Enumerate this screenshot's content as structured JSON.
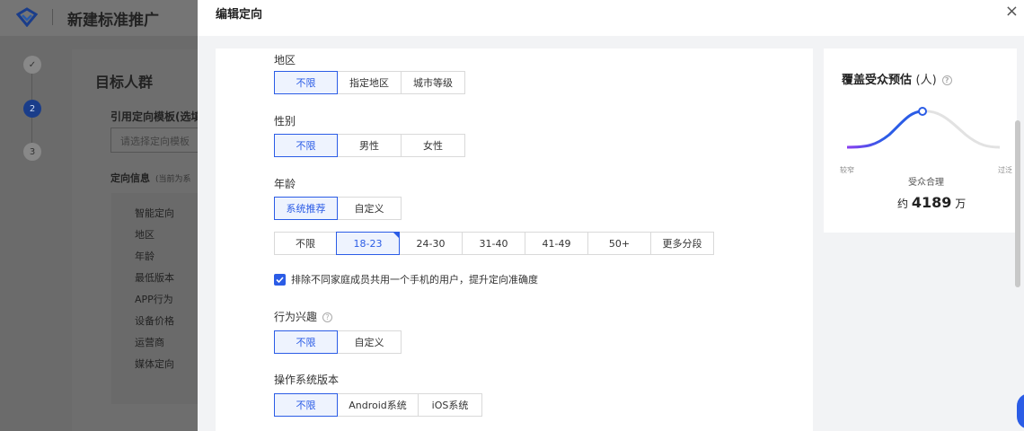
{
  "background": {
    "app_title": "新建标准推广",
    "steps": [
      "✓",
      "2",
      "3"
    ],
    "section_heading": "目标人群",
    "template_label": "引用定向模板(选填)",
    "template_placeholder": "请选择定向模板",
    "info_label": "定向信息",
    "info_note": "(当前为系",
    "list_items": [
      "智能定向",
      "地区",
      "年龄",
      "最低版本",
      "APP行为",
      "设备价格",
      "运营商",
      "媒体定向"
    ]
  },
  "drawer": {
    "title": "编辑定向",
    "close": "×"
  },
  "form": {
    "region": {
      "label": "地区",
      "options": [
        "不限",
        "指定地区",
        "城市等级"
      ],
      "selected": 0
    },
    "gender": {
      "label": "性别",
      "options": [
        "不限",
        "男性",
        "女性"
      ],
      "selected": 0
    },
    "age": {
      "label": "年龄",
      "modes": [
        "系统推荐",
        "自定义"
      ],
      "mode_selected": 0,
      "ranges": [
        "不限",
        "18-23",
        "24-30",
        "31-40",
        "41-49",
        "50+",
        "更多分段"
      ],
      "range_selected": 1
    },
    "exclude_shared": {
      "label": "排除不同家庭成员共用一个手机的用户，提升定向准确度",
      "checked": true
    },
    "interest": {
      "label": "行为兴趣",
      "options": [
        "不限",
        "自定义"
      ],
      "selected": 0
    },
    "os": {
      "label": "操作系统版本",
      "options": [
        "不限",
        "Android系统",
        "iOS系统"
      ],
      "selected": 0
    }
  },
  "estimate": {
    "title": "覆盖受众预估",
    "unit": "(人)",
    "low_label": "较窄",
    "high_label": "过泛",
    "mid_label": "受众合理",
    "value_prefix": "约",
    "value": "4189",
    "value_unit": "万"
  },
  "colors": {
    "accent": "#2b5ce6",
    "curve_start": "#8b3ff0"
  }
}
